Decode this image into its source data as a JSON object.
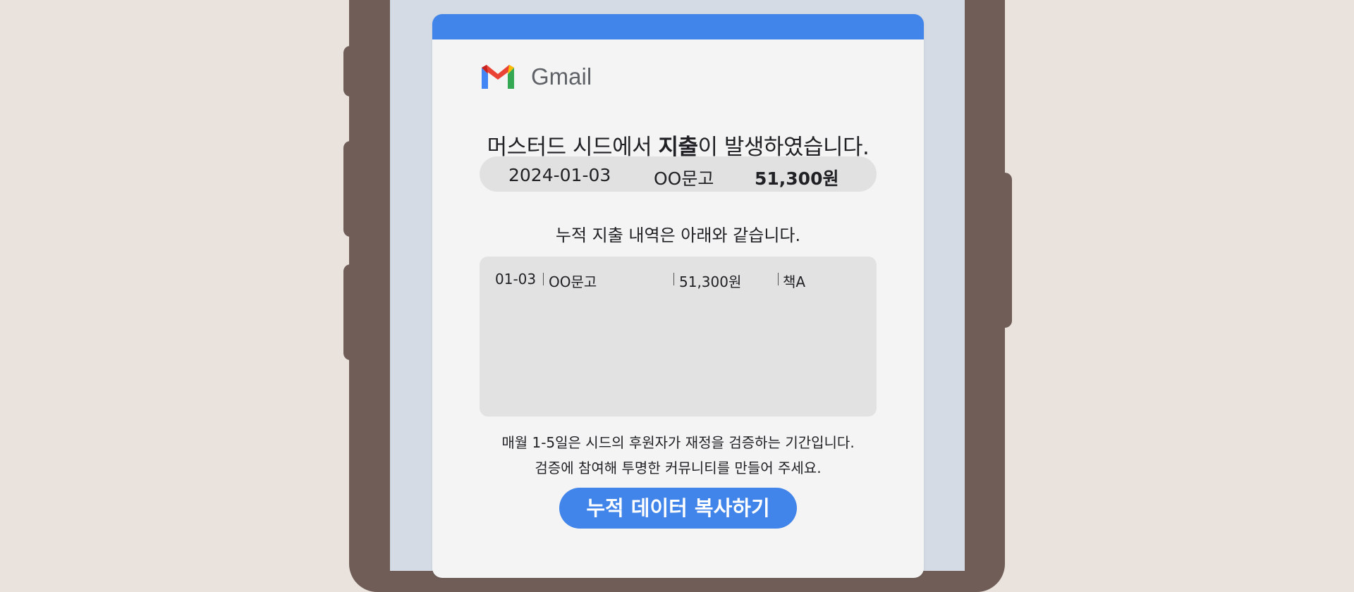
{
  "email": {
    "brand_name": "Gmail",
    "logo_icon": "gmail-logo-icon",
    "accent_color": "#4285ea",
    "headline_before": "머스터드 시드에서 ",
    "headline_bold": "지출",
    "headline_after": "이 발생하였습니다.",
    "transaction": {
      "date": "2024-01-03",
      "vendor": "OO문고",
      "amount": "51,300원"
    },
    "history_title": "누적 지출 내역은 아래와 같습니다.",
    "history": [
      {
        "date": "01-03",
        "vendor": "OO문고",
        "amount": "51,300원",
        "item": "책A"
      }
    ],
    "notice_line1": "매월 1-5일은 시드의 후원자가 재정을 검증하는 기간입니다.",
    "notice_line2": "검증에 참여해 투명한 커뮤니티를 만들어 주세요.",
    "copy_button_label": "누적 데이터 복사하기"
  }
}
